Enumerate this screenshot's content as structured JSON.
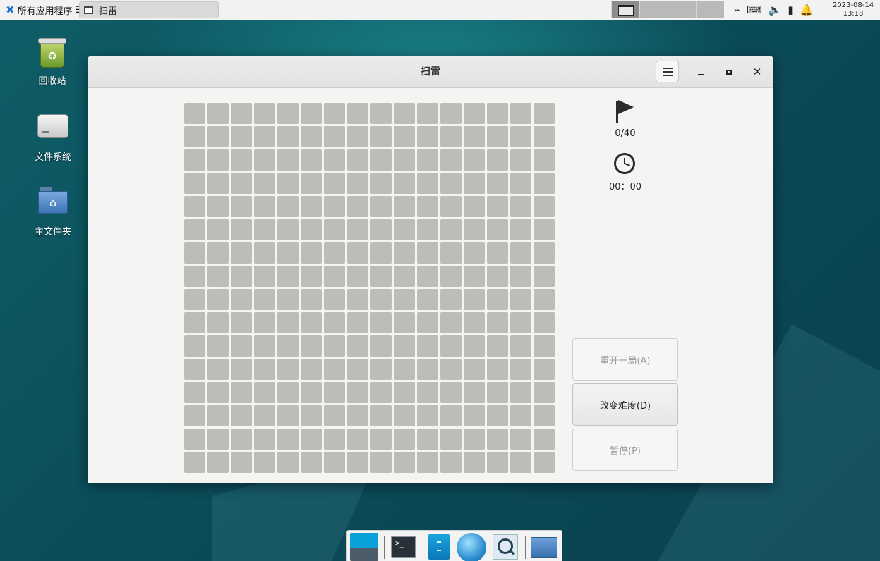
{
  "taskbar": {
    "apps_menu_label": "所有应用程序",
    "apps_menu_suffix": "☰",
    "task_title": "扫雷",
    "clock_date": "2023-08-14",
    "clock_time": "13:18"
  },
  "desktop": {
    "icons": [
      {
        "label": "回收站",
        "icon": "trash-icon"
      },
      {
        "label": "文件系统",
        "icon": "drive-icon"
      },
      {
        "label": "主文件夹",
        "icon": "home-folder-icon"
      }
    ]
  },
  "window": {
    "title": "扫雷",
    "rows": 16,
    "cols": 16,
    "mine_counter": "0/40",
    "timer": "00：00",
    "buttons": {
      "restart": "重开一局(A)",
      "change_difficulty": "改变难度(D)",
      "pause": "暂停(P)"
    }
  },
  "dock": {
    "items": [
      "show-desktop-icon",
      "terminal-icon",
      "file-manager-icon",
      "web-browser-icon",
      "app-finder-icon",
      "folder-icon"
    ]
  },
  "colors": {
    "cell": "#bcbcb8",
    "window_bg": "#f4f4f3",
    "accent": "#1f6fd0"
  }
}
